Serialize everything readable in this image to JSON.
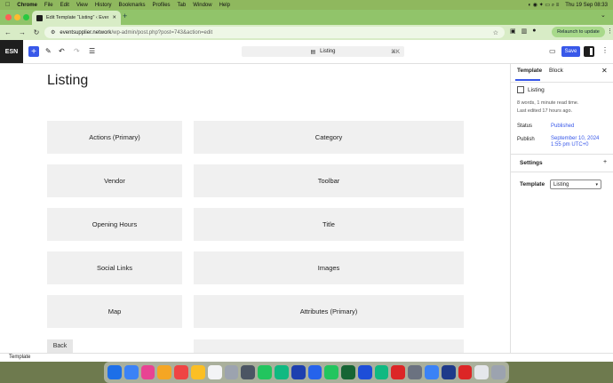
{
  "menubar": {
    "app": "Chrome",
    "items": [
      "File",
      "Edit",
      "View",
      "History",
      "Bookmarks",
      "Profiles",
      "Tab",
      "Window",
      "Help"
    ],
    "clock": "Thu 19 Sep  08:33"
  },
  "browser": {
    "tab_title": "Edit Template “Listing” ‹ Even…",
    "url_host": "eventsupplier.network",
    "url_path": "/wp-admin/post.php?post=743&action=edit",
    "relaunch": "Relaunch to update"
  },
  "wp": {
    "logo": "ESN",
    "command_title": "Listing",
    "command_shortcut": "⌘K",
    "save": "Save",
    "page_title": "Listing",
    "back": "Back",
    "blocks": {
      "left": [
        "Actions (Primary)",
        "Vendor",
        "Opening Hours",
        "Social Links",
        "Map"
      ],
      "right": [
        "Category",
        "Toolbar",
        "Title",
        "Images",
        "Attributes (Primary)",
        ""
      ]
    },
    "footer_breadcrumb": "Template"
  },
  "sidebar": {
    "tabs": [
      "Template",
      "Block"
    ],
    "template_name": "Listing",
    "meta_words": "8 words, 1 minute read time.",
    "meta_edited": "Last edited 17 hours ago.",
    "status_label": "Status",
    "status_value": "Published",
    "publish_label": "Publish",
    "publish_value_1": "September 10, 2024",
    "publish_value_2": "1:55 pm UTC+0",
    "settings": "Settings",
    "template_label": "Template",
    "template_select": "Listing"
  },
  "colors": {
    "accent": "#3858e9",
    "dark": "#1e1e1e",
    "block_bg": "#f0f0f0"
  },
  "dock_colors": [
    "#1d6fe8",
    "#3b82f6",
    "#e84393",
    "#f5a623",
    "#ef4444",
    "#fbbf24",
    "#f3f4f6",
    "#9ca3af",
    "#4b5563",
    "#22c55e",
    "#10b981",
    "#1e40af",
    "#2563eb",
    "#22c55e",
    "#166534",
    "#1d4ed8",
    "#10b981",
    "#dc2626",
    "#6b7280",
    "#3b82f6",
    "#1e3a8a",
    "#dc2626",
    "#e5e7eb",
    "#9ca3af"
  ]
}
